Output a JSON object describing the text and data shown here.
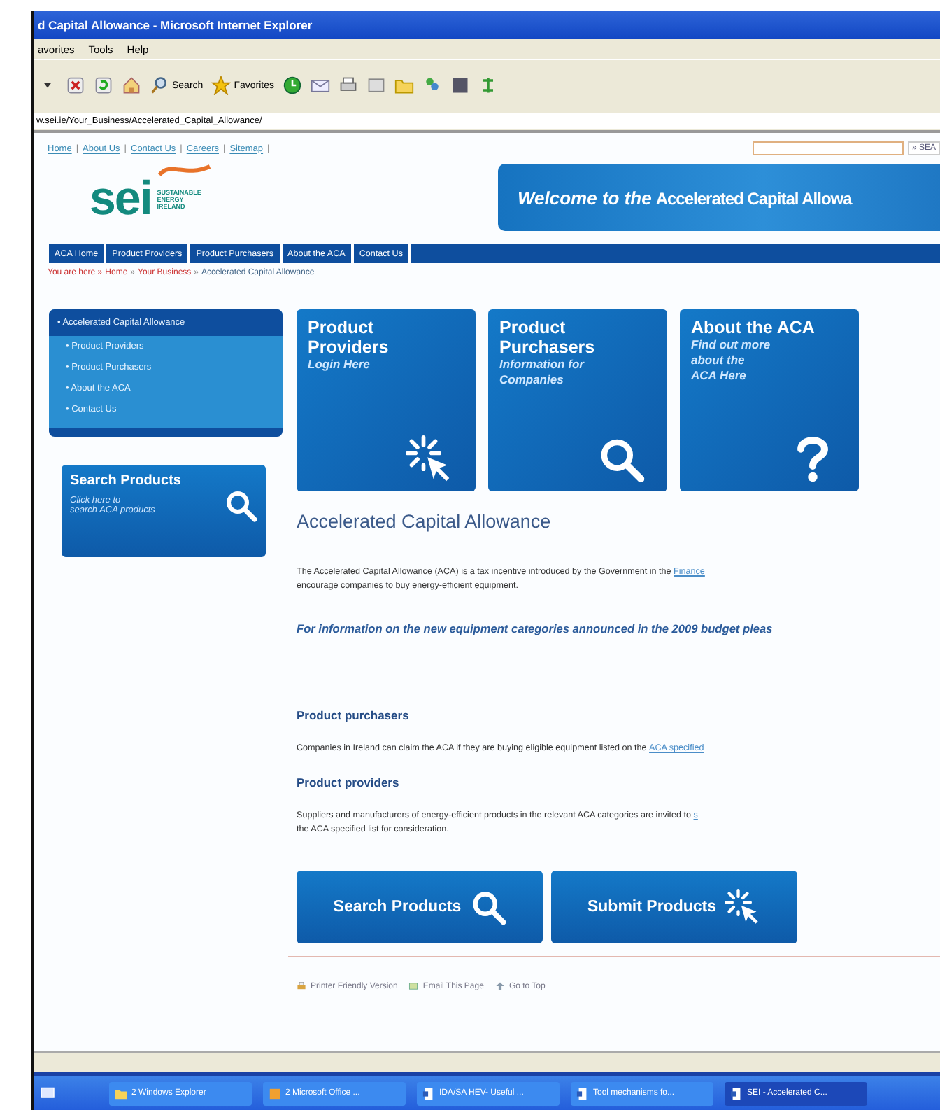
{
  "window": {
    "title": "d Capital Allowance - Microsoft Internet Explorer"
  },
  "menu": [
    "avorites",
    "Tools",
    "Help"
  ],
  "toolbar": {
    "search": "Search",
    "favorites": "Favorites"
  },
  "address": "w.sei.ie/Your_Business/Accelerated_Capital_Allowance/",
  "top_links": [
    "Home",
    "|",
    "About Us",
    "|",
    "Contact Us",
    "|",
    "Careers",
    "|",
    "Sitemap",
    "|"
  ],
  "site_search": {
    "button": "» SEA"
  },
  "logo": {
    "mark": "sei",
    "lines": [
      "SUSTAINABLE",
      "ENERGY",
      "IRELAND"
    ]
  },
  "banner": {
    "lead": "Welcome to the",
    "title": "Accelerated Capital Allowa"
  },
  "nav": [
    "ACA Home",
    "Product Providers",
    "Product Purchasers",
    "About the ACA",
    "Contact Us"
  ],
  "breadcrumb": {
    "prefix": "You are here »",
    "items": [
      {
        "text": "Home",
        "kind": "link"
      },
      {
        "text": "»",
        "kind": "separator"
      },
      {
        "text": "Your Business",
        "kind": "link"
      },
      {
        "text": "»",
        "kind": "separator"
      },
      {
        "text": "Accelerated Capital Allowance",
        "kind": "current"
      }
    ]
  },
  "side_menu": [
    {
      "label": "• Accelerated Capital Allowance",
      "selected": true
    },
    {
      "label": "• Product Providers",
      "selected": false
    },
    {
      "label": "• Product Purchasers",
      "selected": false
    },
    {
      "label": "• About the ACA",
      "selected": false
    },
    {
      "label": "• Contact Us",
      "selected": false
    }
  ],
  "side_promo": {
    "title": "Search Products",
    "lines": [
      "Click here to",
      "search ACA products"
    ],
    "kind": "magnifier"
  },
  "tiles": [
    {
      "title": [
        "Product",
        "Providers"
      ],
      "subtitle": [
        "Login Here"
      ],
      "kind": "cursor"
    },
    {
      "title": [
        "Product",
        "Purchasers"
      ],
      "subtitle": [
        "Information for",
        "Companies"
      ],
      "kind": "magnifier"
    },
    {
      "title": [
        "About the ACA"
      ],
      "subtitle": [
        "Find out more",
        "about the",
        "ACA Here"
      ],
      "kind": "question"
    }
  ],
  "heading": "Accelerated Capital Allowance",
  "intro": [
    {
      "text": "The Accelerated Capital Allowance (ACA) is a tax incentive introduced by the Government in the",
      "link": "Finance"
    },
    {
      "text": "encourage companies to buy energy-efficient equipment."
    }
  ],
  "notice": "For information on the new equipment categories announced in the 2009 budget pleas",
  "sections": [
    {
      "heading": "Product purchasers",
      "lines": [
        {
          "text": "Companies in Ireland can claim the ACA if they are buying eligible equipment listed on the",
          "link": "ACA specified"
        }
      ]
    },
    {
      "heading": "Product providers",
      "lines": [
        {
          "text": "Suppliers and manufacturers of energy-efficient products in the relevant ACA categories are invited to",
          "link": "s"
        },
        {
          "text": "the ACA specified list for consideration."
        }
      ]
    }
  ],
  "buttons": [
    {
      "label": "Search Products",
      "kind": "magnifier"
    },
    {
      "label": "Submit Products",
      "kind": "cursor"
    }
  ],
  "footer_links": [
    {
      "label": "Printer Friendly Version",
      "kind": "printer"
    },
    {
      "label": "Email This Page",
      "kind": "mail"
    },
    {
      "label": "Go to Top",
      "kind": "arrow"
    }
  ],
  "taskbar": [
    {
      "label": "2 Windows Explorer",
      "kind": "folder",
      "selected": false
    },
    {
      "label": "2 Microsoft Office ...",
      "kind": "office",
      "selected": false
    },
    {
      "label": "IDA/SA HEV- Useful ...",
      "kind": "doc",
      "selected": false
    },
    {
      "label": "Tool mechanisms fo...",
      "kind": "doc",
      "selected": false
    },
    {
      "label": "SEI - Accelerated C...",
      "kind": "doc",
      "selected": true
    }
  ]
}
